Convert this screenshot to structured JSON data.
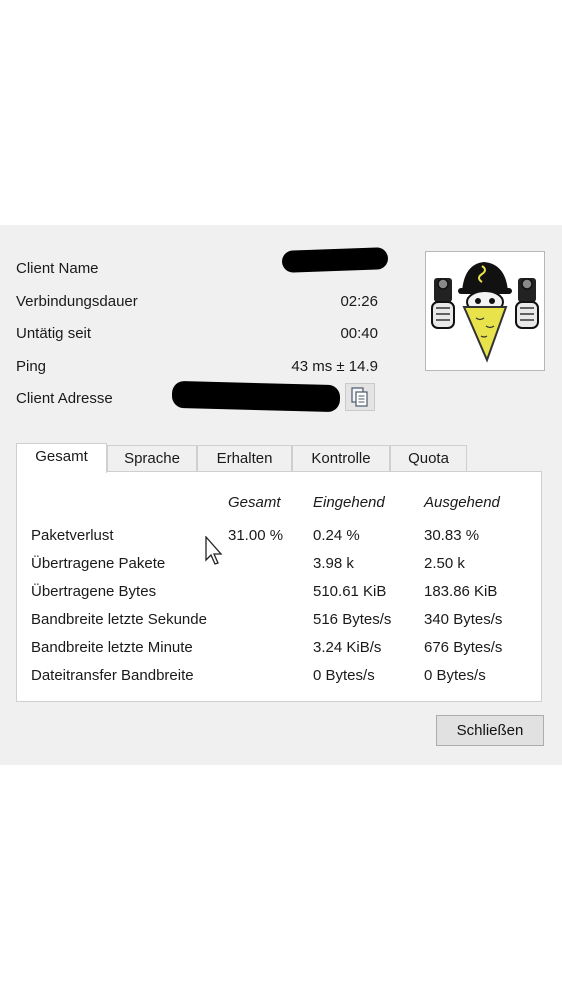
{
  "client_info": {
    "rows": [
      {
        "label": "Client Name",
        "value": ""
      },
      {
        "label": "Verbindungsdauer",
        "value": "02:26"
      },
      {
        "label": "Untätig seit",
        "value": "00:40"
      },
      {
        "label": "Ping",
        "value": "43 ms ± 14.9"
      },
      {
        "label": "Client Adresse",
        "value": ""
      }
    ]
  },
  "icons": {
    "copy": "copy-icon",
    "avatar": "bandit-gunman-avatar",
    "cursor": "mouse-pointer-icon"
  },
  "tabs": [
    {
      "label": "Gesamt",
      "active": true
    },
    {
      "label": "Sprache",
      "active": false
    },
    {
      "label": "Erhalten",
      "active": false
    },
    {
      "label": "Kontrolle",
      "active": false
    },
    {
      "label": "Quota",
      "active": false
    }
  ],
  "stats": {
    "columns": [
      "",
      "Gesamt",
      "Eingehend",
      "Ausgehend"
    ],
    "rows": [
      {
        "label": "Paketverlust",
        "gesamt": "31.00 %",
        "eingehend": "0.24 %",
        "ausgehend": "30.83 %"
      },
      {
        "label": "Übertragene Pakete",
        "gesamt": "",
        "eingehend": "3.98 k",
        "ausgehend": "2.50 k"
      },
      {
        "label": "Übertragene Bytes",
        "gesamt": "",
        "eingehend": "510.61 KiB",
        "ausgehend": "183.86 KiB"
      },
      {
        "label": "Bandbreite letzte Sekunde",
        "gesamt": "",
        "eingehend": "516 Bytes/s",
        "ausgehend": "340 Bytes/s"
      },
      {
        "label": "Bandbreite letzte Minute",
        "gesamt": "",
        "eingehend": "3.24 KiB/s",
        "ausgehend": "676 Bytes/s"
      },
      {
        "label": "Dateitransfer Bandbreite",
        "gesamt": "",
        "eingehend": "0 Bytes/s",
        "ausgehend": "0 Bytes/s"
      }
    ]
  },
  "buttons": {
    "close_label": "Schließen"
  },
  "colors": {
    "dialog_bg": "#f0f0f0",
    "panel_bg": "#ffffff",
    "avatar_yellow": "#e8e34a"
  }
}
